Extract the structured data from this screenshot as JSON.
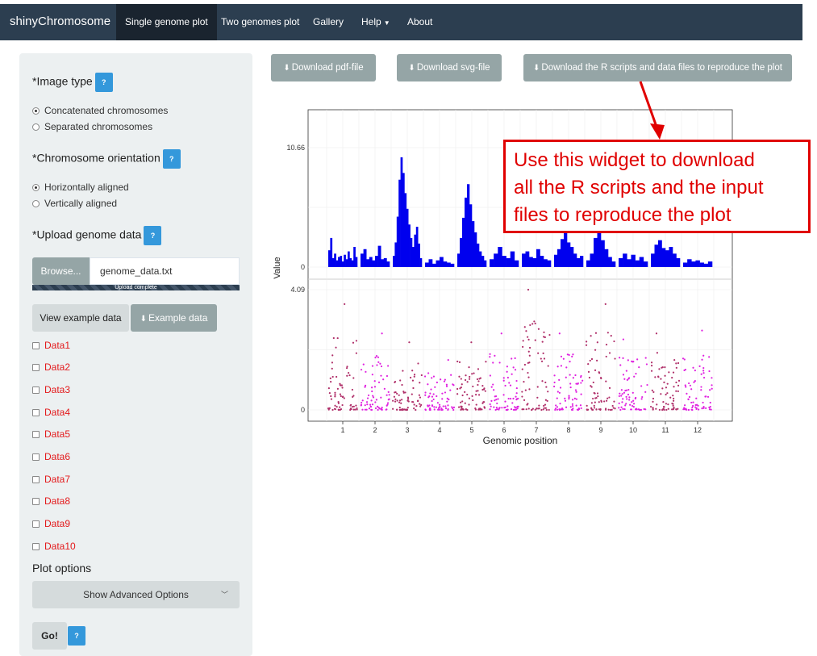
{
  "navbar": {
    "brand": "shinyChromosome",
    "items": [
      {
        "label": "Single genome plot"
      },
      {
        "label": "Two genomes plot"
      },
      {
        "label": "Gallery"
      },
      {
        "label": "Help"
      },
      {
        "label": "About"
      }
    ]
  },
  "sidebar": {
    "image_type": {
      "title": "*Image type",
      "help": "?",
      "options": [
        "Concatenated chromosomes",
        "Separated chromosomes"
      ],
      "selected": "Concatenated chromosomes"
    },
    "orientation": {
      "title": "*Chromosome orientation",
      "help": "?",
      "options": [
        "Horizontally aligned",
        "Vertically aligned"
      ],
      "selected": "Horizontally aligned"
    },
    "upload": {
      "title": "*Upload genome data",
      "help": "?",
      "browse_label": "Browse...",
      "file_name": "genome_data.txt",
      "progress_text": "Upload complete",
      "progress": 1.0
    },
    "view_example_label": "View example data",
    "example_data_label": "Example data",
    "data_checkboxes": [
      "Data1",
      "Data2",
      "Data3",
      "Data4",
      "Data5",
      "Data6",
      "Data7",
      "Data8",
      "Data9",
      "Data10"
    ],
    "plot_options_label": "Plot options",
    "advanced_options_label": "Show Advanced Options",
    "go_label": "Go!",
    "go_help": "?"
  },
  "downloads": {
    "pdf_label": "Download pdf-file",
    "svg_label": "Download svg-file",
    "scripts_label": "Download the R scripts and data files to reproduce the plot"
  },
  "callout": {
    "text_lines": [
      "Use this widget to download",
      "all the R scripts and the input",
      "files to reproduce the plot"
    ],
    "color": "#e00000"
  },
  "colors": {
    "navbar": "#2c3e50",
    "accent": "#3498db",
    "bar": "#0000ee",
    "point_dark": "#b0306a",
    "point_light": "#e022e0"
  },
  "chart_data": {
    "type": "bar",
    "xlabel": "Genomic position",
    "ylabel": "Value",
    "x_ticks": [
      "1",
      "2",
      "3",
      "4",
      "5",
      "6",
      "7",
      "8",
      "9",
      "10",
      "11",
      "12"
    ],
    "top_panel": {
      "type": "bar",
      "ylim": [
        0,
        10.66
      ],
      "y_ticks": [
        "10.66",
        "0"
      ],
      "chromosome_values": [
        [
          1.5,
          2.6,
          0.8,
          1.2,
          0.6,
          0.9,
          1.0,
          0.5,
          1.1,
          0.7,
          1.4,
          0.8,
          0.6,
          1.8,
          0.9
        ],
        [
          1.2,
          1.6,
          0.7,
          0.9,
          0.6,
          1.0,
          1.9,
          0.7,
          0.8,
          0.5
        ],
        [
          1.0,
          2.2,
          4.5,
          7.8,
          9.8,
          8.4,
          6.6,
          5.2,
          3.8,
          2.6,
          1.8,
          2.9,
          3.6,
          2.1,
          0.8
        ],
        [
          0.4,
          0.7,
          0.3,
          0.6,
          0.9,
          0.5,
          0.4,
          0.3
        ],
        [
          1.2,
          2.6,
          4.4,
          6.2,
          7.4,
          5.6,
          4.1,
          3.1,
          2.1,
          1.4,
          1.0,
          0.6
        ],
        [
          0.7,
          1.2,
          1.8,
          1.0,
          0.8,
          1.4,
          0.6
        ],
        [
          1.2,
          1.4,
          0.9,
          0.8,
          1.6,
          1.0,
          0.7,
          0.6
        ],
        [
          1.1,
          1.6,
          2.5,
          3.1,
          2.2,
          1.8,
          1.2,
          0.8,
          1.0
        ],
        [
          0.6,
          1.2,
          2.6,
          3.3,
          2.4,
          1.6,
          0.9,
          0.5
        ],
        [
          0.8,
          1.2,
          0.7,
          1.1,
          0.6,
          0.9,
          0.5
        ],
        [
          1.2,
          2.0,
          2.4,
          1.7,
          1.5,
          1.8,
          1.2,
          0.8
        ],
        [
          0.4,
          0.7,
          0.5,
          0.6,
          0.4,
          0.3,
          0.5
        ]
      ]
    },
    "bottom_panel": {
      "type": "scatter",
      "ylim": [
        0,
        4.09
      ],
      "y_ticks": [
        "4.09",
        "0"
      ],
      "chromosome_peaks": [
        3.6,
        2.6,
        2.3,
        1.7,
        2.3,
        2.6,
        4.09,
        2.6,
        3.6,
        2.4,
        2.6,
        2.7
      ]
    },
    "grid": true
  }
}
